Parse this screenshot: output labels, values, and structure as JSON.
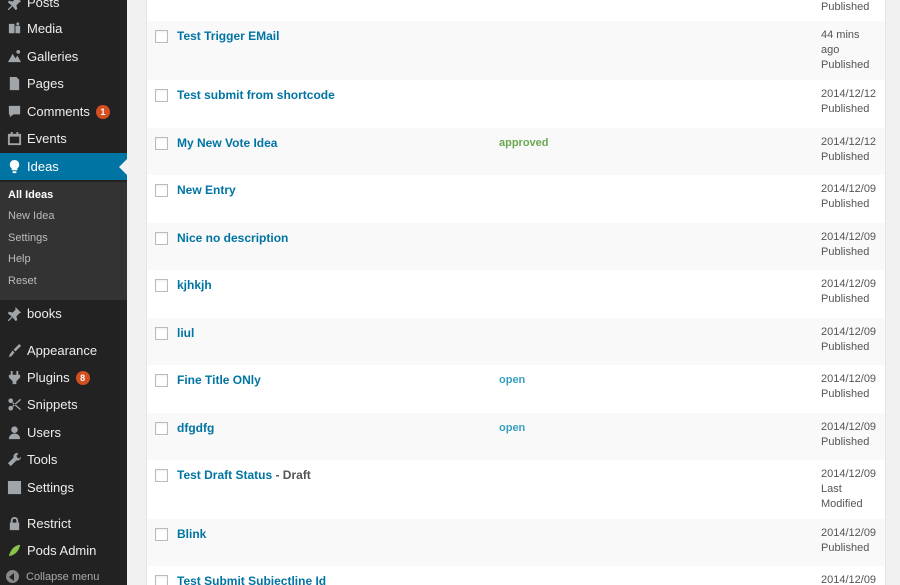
{
  "sidebar": {
    "items": [
      {
        "label": "Posts",
        "icon": "pin-icon"
      },
      {
        "label": "Media",
        "icon": "media-icon"
      },
      {
        "label": "Galleries",
        "icon": "gallery-icon"
      },
      {
        "label": "Pages",
        "icon": "pages-icon"
      },
      {
        "label": "Comments",
        "icon": "comments-icon",
        "badge": "1"
      },
      {
        "label": "Events",
        "icon": "calendar-icon"
      },
      {
        "label": "Ideas",
        "icon": "lightbulb-icon",
        "active": true
      },
      {
        "label": "books",
        "icon": "pin-icon"
      },
      {
        "label": "Appearance",
        "icon": "appearance-icon"
      },
      {
        "label": "Plugins",
        "icon": "plugins-icon",
        "badge": "8"
      },
      {
        "label": "Snippets",
        "icon": "scissors-icon"
      },
      {
        "label": "Users",
        "icon": "users-icon"
      },
      {
        "label": "Tools",
        "icon": "wrench-icon"
      },
      {
        "label": "Settings",
        "icon": "settings-icon"
      },
      {
        "label": "Restrict",
        "icon": "lock-icon"
      },
      {
        "label": "Pods Admin",
        "icon": "pods-icon"
      }
    ],
    "submenu": [
      "All Ideas",
      "New Idea",
      "Settings",
      "Help",
      "Reset"
    ],
    "collapse_label": "Collapse menu"
  },
  "rows": [
    {
      "title": "",
      "status": "",
      "date": [
        "Published"
      ]
    },
    {
      "title": "Test Trigger EMail",
      "status": "",
      "date": [
        "44 mins",
        "ago",
        "Published"
      ]
    },
    {
      "title": "Test submit from shortcode",
      "status": "",
      "date": [
        "2014/12/12",
        "Published"
      ]
    },
    {
      "title": "My New Vote Idea",
      "status": "approved",
      "date": [
        "2014/12/12",
        "Published"
      ]
    },
    {
      "title": "New Entry",
      "status": "",
      "date": [
        "2014/12/09",
        "Published"
      ]
    },
    {
      "title": "Nice no description",
      "status": "",
      "date": [
        "2014/12/09",
        "Published"
      ]
    },
    {
      "title": "kjhkjh",
      "status": "",
      "date": [
        "2014/12/09",
        "Published"
      ]
    },
    {
      "title": "liul",
      "status": "",
      "date": [
        "2014/12/09",
        "Published"
      ]
    },
    {
      "title": "Fine Title ONly",
      "status": "open",
      "date": [
        "2014/12/09",
        "Published"
      ]
    },
    {
      "title": "dfgdfg",
      "status": "open",
      "date": [
        "2014/12/09",
        "Published"
      ]
    },
    {
      "title": "Test Draft Status",
      "state": " - Draft",
      "status": "",
      "date": [
        "2014/12/09",
        "Last",
        "Modified"
      ]
    },
    {
      "title": "Blink",
      "status": "",
      "date": [
        "2014/12/09",
        "Published"
      ]
    },
    {
      "title": "Test Submit Subjectline Id",
      "status": "",
      "date": [
        "2014/12/09"
      ]
    }
  ],
  "colors": {
    "sidebar": "#222222",
    "active": "#0074a2",
    "link": "#0074a2",
    "badge": "#d54e21",
    "approved": "#6aa84f",
    "open": "#3aa0c0"
  }
}
